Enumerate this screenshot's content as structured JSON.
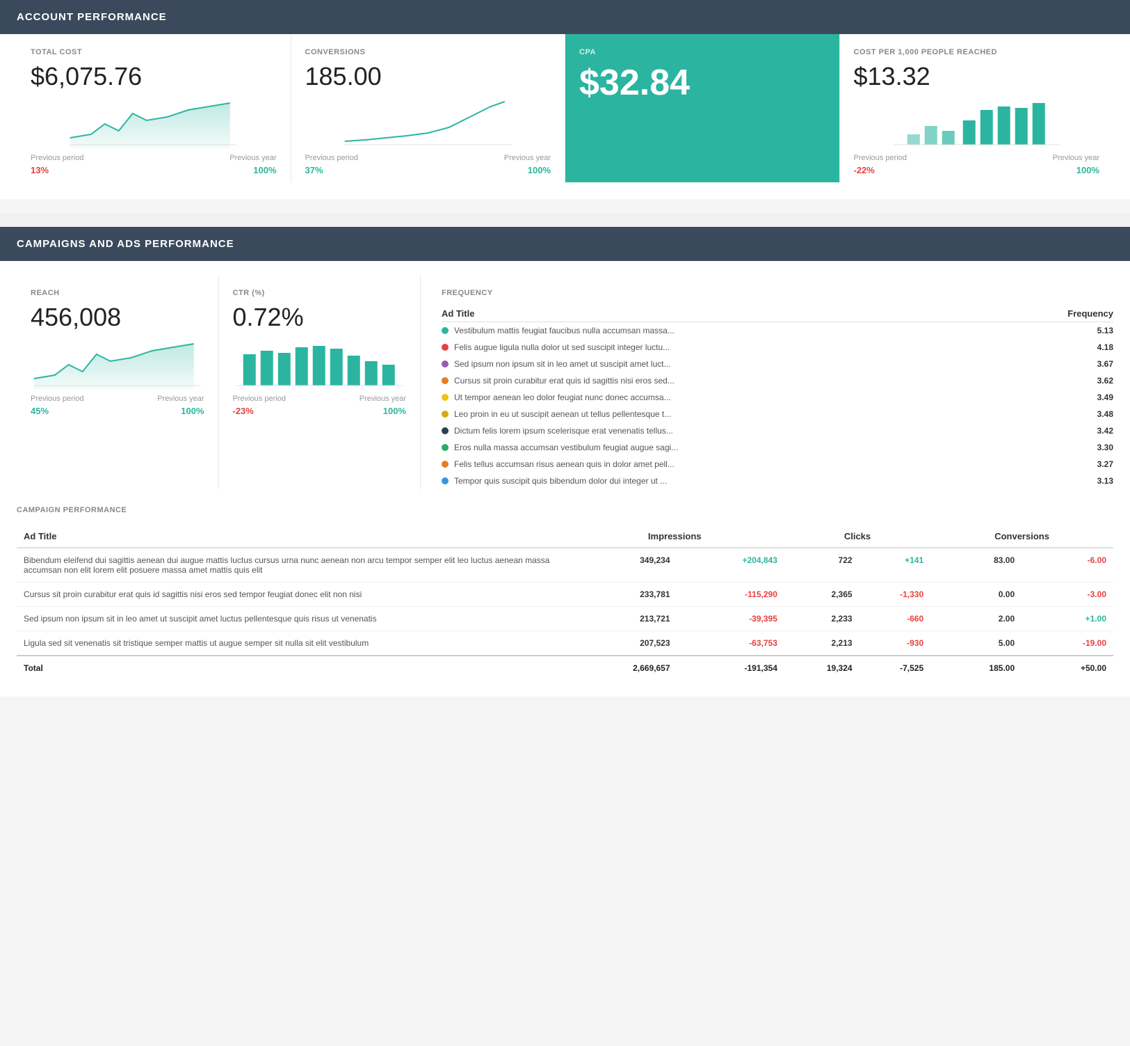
{
  "account": {
    "header": "ACCOUNT PERFORMANCE",
    "metrics": [
      {
        "id": "total-cost",
        "label": "TOTAL COST",
        "value": "$6,075.76",
        "highlighted": false,
        "period_label": "Previous period",
        "year_label": "Previous year",
        "period_change": "13%",
        "year_change": "100%",
        "period_neg": false,
        "year_neg": false
      },
      {
        "id": "conversions",
        "label": "CONVERSIONS",
        "value": "185.00",
        "highlighted": false,
        "period_label": "Previous period",
        "year_label": "Previous year",
        "period_change": "37%",
        "year_change": "100%",
        "period_neg": false,
        "year_neg": false
      },
      {
        "id": "cpa",
        "label": "CPA",
        "value": "$32.84",
        "highlighted": true,
        "period_label": null,
        "year_label": null,
        "period_change": null,
        "year_change": null
      },
      {
        "id": "cost-per-1000",
        "label": "COST PER 1,000 PEOPLE REACHED",
        "value": "$13.32",
        "highlighted": false,
        "period_label": "Previous period",
        "year_label": "Previous year",
        "period_change": "-22%",
        "year_change": "100%",
        "period_neg": true,
        "year_neg": false
      }
    ]
  },
  "campaigns": {
    "header": "CAMPAIGNS AND ADS PERFORMANCE",
    "metrics": [
      {
        "id": "reach",
        "label": "REACH",
        "value": "456,008",
        "period_label": "Previous period",
        "year_label": "Previous year",
        "period_change": "45%",
        "year_change": "100%",
        "period_neg": false,
        "year_neg": false
      },
      {
        "id": "ctr",
        "label": "CTR (%)",
        "value": "0.72%",
        "period_label": "Previous period",
        "year_label": "Previous year",
        "period_change": "-23%",
        "year_change": "100%",
        "period_neg": true,
        "year_neg": false
      }
    ],
    "frequency": {
      "title": "FREQUENCY",
      "col_ad": "Ad Title",
      "col_freq": "Frequency",
      "rows": [
        {
          "color": "#2bb5a0",
          "label": "Vestibulum mattis feugiat faucibus nulla accumsan massa...",
          "value": "5.13"
        },
        {
          "color": "#e84040",
          "label": "Felis augue ligula nulla dolor ut sed suscipit integer luctu...",
          "value": "4.18"
        },
        {
          "color": "#9b59b6",
          "label": "Sed ipsum non ipsum sit in leo amet ut suscipit amet luct...",
          "value": "3.67"
        },
        {
          "color": "#e67e22",
          "label": "Cursus sit proin curabitur erat quis id sagittis nisi eros sed...",
          "value": "3.62"
        },
        {
          "color": "#f1c40f",
          "label": "Ut tempor aenean leo dolor feugiat nunc donec accumsa...",
          "value": "3.49"
        },
        {
          "color": "#d4ac0d",
          "label": "Leo proin in eu ut suscipit aenean ut tellus pellentesque t...",
          "value": "3.48"
        },
        {
          "color": "#2c3e50",
          "label": "Dictum felis lorem ipsum scelerisque erat venenatis tellus...",
          "value": "3.42"
        },
        {
          "color": "#27ae60",
          "label": "Eros nulla massa accumsan vestibulum feugiat augue sagi...",
          "value": "3.30"
        },
        {
          "color": "#e67e22",
          "label": "Felis tellus accumsan risus aenean quis in dolor amet pell...",
          "value": "3.27"
        },
        {
          "color": "#3498db",
          "label": "Tempor quis suscipit quis bibendum dolor dui integer ut ...",
          "value": "3.13"
        }
      ]
    },
    "campaign_perf": {
      "title": "CAMPAIGN PERFORMANCE",
      "col_ad": "Ad Title",
      "col_impressions": "Impressions",
      "col_clicks": "Clicks",
      "col_conversions": "Conversions",
      "rows": [
        {
          "ad": "Bibendum eleifend dui sagittis aenean dui augue mattis luctus cursus urna nunc aenean non arcu tempor semper elit leo luctus aenean massa accumsan non elit lorem elit posuere massa amet mattis quis elit",
          "impressions": "349,234",
          "imp_change": "+204,843",
          "imp_change_neg": false,
          "clicks": "722",
          "clicks_change": "+141",
          "clicks_change_neg": false,
          "conversions": "83.00",
          "conv_change": "-6.00",
          "conv_change_neg": true
        },
        {
          "ad": "Cursus sit proin curabitur erat quis id sagittis nisi eros sed tempor feugiat donec elit non nisi",
          "impressions": "233,781",
          "imp_change": "-115,290",
          "imp_change_neg": true,
          "clicks": "2,365",
          "clicks_change": "-1,330",
          "clicks_change_neg": true,
          "conversions": "0.00",
          "conv_change": "-3.00",
          "conv_change_neg": true
        },
        {
          "ad": "Sed ipsum non ipsum sit in leo amet ut suscipit amet luctus pellentesque quis risus ut venenatis",
          "impressions": "213,721",
          "imp_change": "-39,395",
          "imp_change_neg": true,
          "clicks": "2,233",
          "clicks_change": "-660",
          "clicks_change_neg": true,
          "conversions": "2.00",
          "conv_change": "+1.00",
          "conv_change_neg": false
        },
        {
          "ad": "Ligula sed sit venenatis sit tristique semper mattis ut augue semper sit nulla sit elit vestibulum",
          "impressions": "207,523",
          "imp_change": "-63,753",
          "imp_change_neg": true,
          "clicks": "2,213",
          "clicks_change": "-930",
          "clicks_change_neg": true,
          "conversions": "5.00",
          "conv_change": "-19.00",
          "conv_change_neg": true
        }
      ],
      "total_row": {
        "label": "Total",
        "impressions": "2,669,657",
        "imp_change": "-191,354",
        "imp_change_neg": true,
        "clicks": "19,324",
        "clicks_change": "-7,525",
        "clicks_change_neg": true,
        "conversions": "185.00",
        "conv_change": "+50.00",
        "conv_change_neg": false
      }
    }
  }
}
